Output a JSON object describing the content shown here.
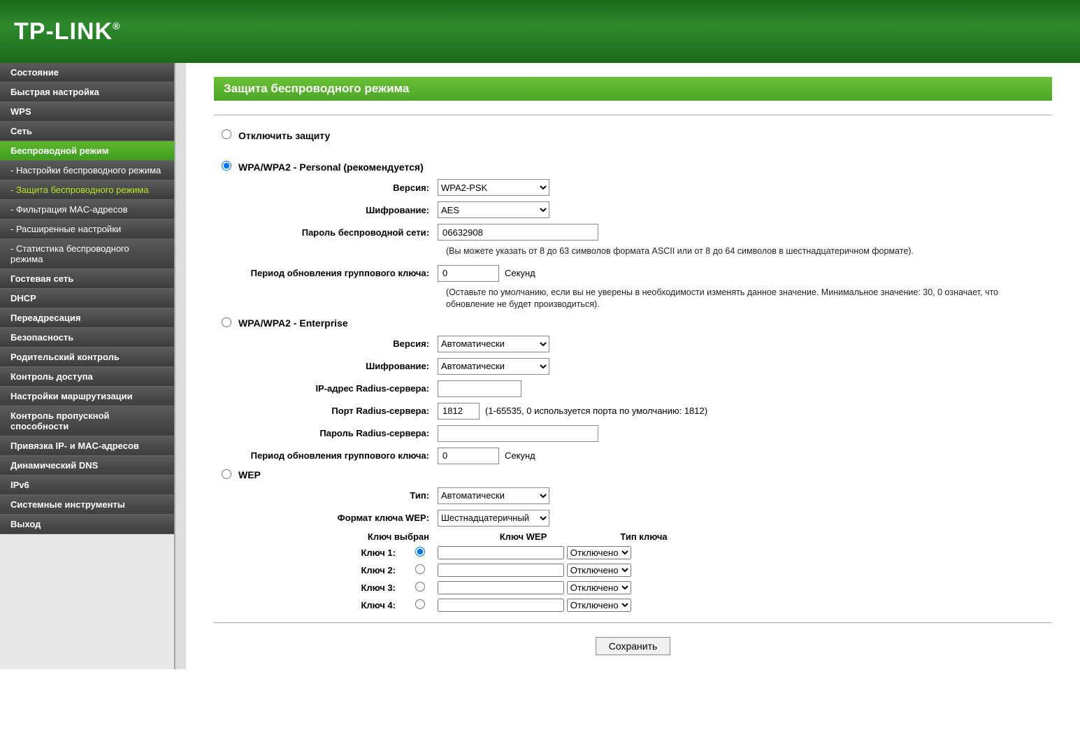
{
  "logo": "TP-LINK",
  "sidebar": {
    "items": [
      {
        "id": "status",
        "label": "Состояние"
      },
      {
        "id": "quick",
        "label": "Быстрая настройка"
      },
      {
        "id": "wps",
        "label": "WPS"
      },
      {
        "id": "net",
        "label": "Сеть"
      },
      {
        "id": "wireless",
        "label": "Беспроводной режим"
      },
      {
        "id": "wl-settings",
        "label": "- Настройки беспроводного режима"
      },
      {
        "id": "wl-security",
        "label": "- Защита беспроводного режима"
      },
      {
        "id": "wl-mac",
        "label": "- Фильтрация MAC-адресов"
      },
      {
        "id": "wl-adv",
        "label": "- Расширенные настройки"
      },
      {
        "id": "wl-stats",
        "label": "- Статистика беспроводного режима"
      },
      {
        "id": "guest",
        "label": "Гостевая сеть"
      },
      {
        "id": "dhcp",
        "label": "DHCP"
      },
      {
        "id": "fwd",
        "label": "Переадресация"
      },
      {
        "id": "sec",
        "label": "Безопасность"
      },
      {
        "id": "parent",
        "label": "Родительский контроль"
      },
      {
        "id": "access",
        "label": "Контроль доступа"
      },
      {
        "id": "route",
        "label": "Настройки маршрутизации"
      },
      {
        "id": "bw",
        "label": "Контроль пропускной способности"
      },
      {
        "id": "bind",
        "label": "Привязка IP- и MAC-адресов"
      },
      {
        "id": "ddns",
        "label": "Динамический DNS"
      },
      {
        "id": "ipv6",
        "label": "IPv6"
      },
      {
        "id": "tools",
        "label": "Системные инструменты"
      },
      {
        "id": "logout",
        "label": "Выход"
      }
    ]
  },
  "page": {
    "title": "Защита беспроводного режима",
    "disable_label": "Отключить защиту",
    "wpa_personal_label": "WPA/WPA2 - Personal (рекомендуется)",
    "wpa_enterprise_label": "WPA/WPA2 - Enterprise",
    "wep_label": "WEP",
    "labels": {
      "version": "Версия:",
      "encryption": "Шифрование:",
      "psk": "Пароль беспроводной сети:",
      "group_key": "Период обновления группового ключа:",
      "radius_ip": "IP-адрес Radius-сервера:",
      "radius_port": "Порт Radius-сервера:",
      "radius_pw": "Пароль Radius-сервера:",
      "wep_type": "Тип:",
      "wep_format": "Формат ключа WEP:",
      "key_selected": "Ключ выбран",
      "wep_key": "Ключ WEP",
      "key_type": "Тип ключа",
      "key1": "Ключ 1:",
      "key2": "Ключ 2:",
      "key3": "Ключ 3:",
      "key4": "Ключ 4:",
      "seconds": "Секунд"
    },
    "values": {
      "version_personal": "WPA2-PSK",
      "encryption_personal": "AES",
      "psk": "06632908",
      "group_key_personal": "0",
      "version_enterprise": "Автоматически",
      "encryption_enterprise": "Автоматически",
      "radius_ip": "",
      "radius_port": "1812",
      "radius_pw": "",
      "group_key_enterprise": "0",
      "wep_type": "Автоматически",
      "wep_format": "Шестнадцатеричный",
      "wep_key1": "",
      "wep_type1": "Отключено",
      "wep_key2": "",
      "wep_type2": "Отключено",
      "wep_key3": "",
      "wep_type3": "Отключено",
      "wep_key4": "",
      "wep_type4": "Отключено"
    },
    "hints": {
      "psk": "(Вы можете указать от 8 до 63 символов формата ASCII или от 8 до 64 символов в шестнадцатеричном формате).",
      "group_key": "(Оставьте по умолчанию, если вы не уверены в необходимости изменять данное значение. Минимальное значение: 30, 0 означает, что обновление не будет производиться).",
      "radius_port": "(1-65535, 0 используется порта по умолчанию: 1812)"
    },
    "save": "Сохранить"
  }
}
